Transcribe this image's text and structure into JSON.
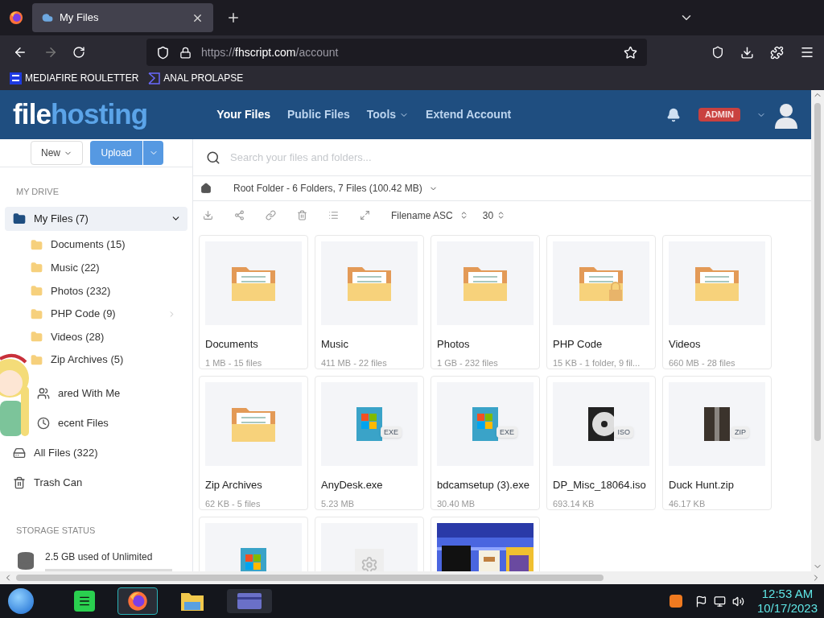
{
  "browser": {
    "tabs": [
      {
        "title": "My Files",
        "selected": true
      }
    ],
    "url": {
      "scheme": "https://",
      "host": "fhscript.com",
      "path": "/account"
    },
    "bookmarks": [
      {
        "label": "MEDIAFIRE ROULETTER",
        "kind": "mft"
      },
      {
        "label": "ANAL PROLAPSE",
        "kind": "sigma"
      }
    ]
  },
  "site": {
    "logo": {
      "first": "file",
      "second": "hosting"
    },
    "nav": [
      {
        "label": "Your Files",
        "selected": true,
        "dropdown": false
      },
      {
        "label": "Public Files",
        "selected": false,
        "dropdown": false
      },
      {
        "label": "Tools",
        "selected": false,
        "dropdown": true
      },
      {
        "label": "Extend Account",
        "selected": false,
        "dropdown": false
      }
    ],
    "badge": "ADMIN"
  },
  "actions": {
    "new_button": "New",
    "upload_button": "Upload"
  },
  "search": {
    "placeholder": "Search your files and folders..."
  },
  "sidebar": {
    "section": "MY DRIVE",
    "items": [
      {
        "kind": "drive",
        "label": "My Files (7)",
        "selected": true,
        "expanded": true,
        "children": [
          {
            "label": "Documents (15)",
            "has_children": false
          },
          {
            "label": "Music (22)",
            "has_children": false
          },
          {
            "label": "Photos (232)",
            "has_children": false
          },
          {
            "label": "PHP Code (9)",
            "has_children": true
          },
          {
            "label": "Videos (28)",
            "has_children": false
          },
          {
            "label": "Zip Archives (5)",
            "has_children": false
          }
        ]
      },
      {
        "kind": "shared",
        "label": "ared With Me",
        "selected": false
      },
      {
        "kind": "recent",
        "label": "ecent Files",
        "selected": false
      },
      {
        "kind": "all",
        "label": "All Files (322)",
        "selected": false
      },
      {
        "kind": "trash",
        "label": "Trash Can",
        "selected": false
      }
    ],
    "storage": {
      "heading": "STORAGE STATUS",
      "text": "2.5 GB used of Unlimited"
    }
  },
  "breadcrumb": "Root Folder - 6 Folders, 7 Files (100.42 MB)",
  "sort": {
    "label": "Filename ASC",
    "per_page": "30"
  },
  "files": [
    {
      "kind": "folder",
      "name": "Documents",
      "meta": "1 MB - 15 files",
      "locked": false
    },
    {
      "kind": "folder",
      "name": "Music",
      "meta": "411 MB - 22 files",
      "locked": false
    },
    {
      "kind": "folder",
      "name": "Photos",
      "meta": "1 GB - 232 files",
      "locked": false
    },
    {
      "kind": "folder",
      "name": "PHP Code",
      "meta": "15 KB - 1 folder, 9 fil...",
      "locked": true
    },
    {
      "kind": "folder",
      "name": "Videos",
      "meta": "660 MB - 28 files",
      "locked": false
    },
    {
      "kind": "folder",
      "name": "Zip Archives",
      "meta": "62 KB - 5 files",
      "locked": false
    },
    {
      "kind": "exe",
      "name": "AnyDesk.exe",
      "meta": "5.23 MB",
      "badge": "EXE"
    },
    {
      "kind": "exe",
      "name": "bdcamsetup (3).exe",
      "meta": "30.40 MB",
      "badge": "EXE"
    },
    {
      "kind": "iso",
      "name": "DP_Misc_18064.iso",
      "meta": "693.14 KB",
      "badge": "ISO"
    },
    {
      "kind": "zip",
      "name": "Duck Hunt.zip",
      "meta": "46.17 KB",
      "badge": "ZIP"
    },
    {
      "kind": "exe"
    },
    {
      "kind": "gear"
    },
    {
      "kind": "picture"
    }
  ],
  "taskbar": {
    "time": "12:53 AM",
    "date": "10/17/2023"
  }
}
